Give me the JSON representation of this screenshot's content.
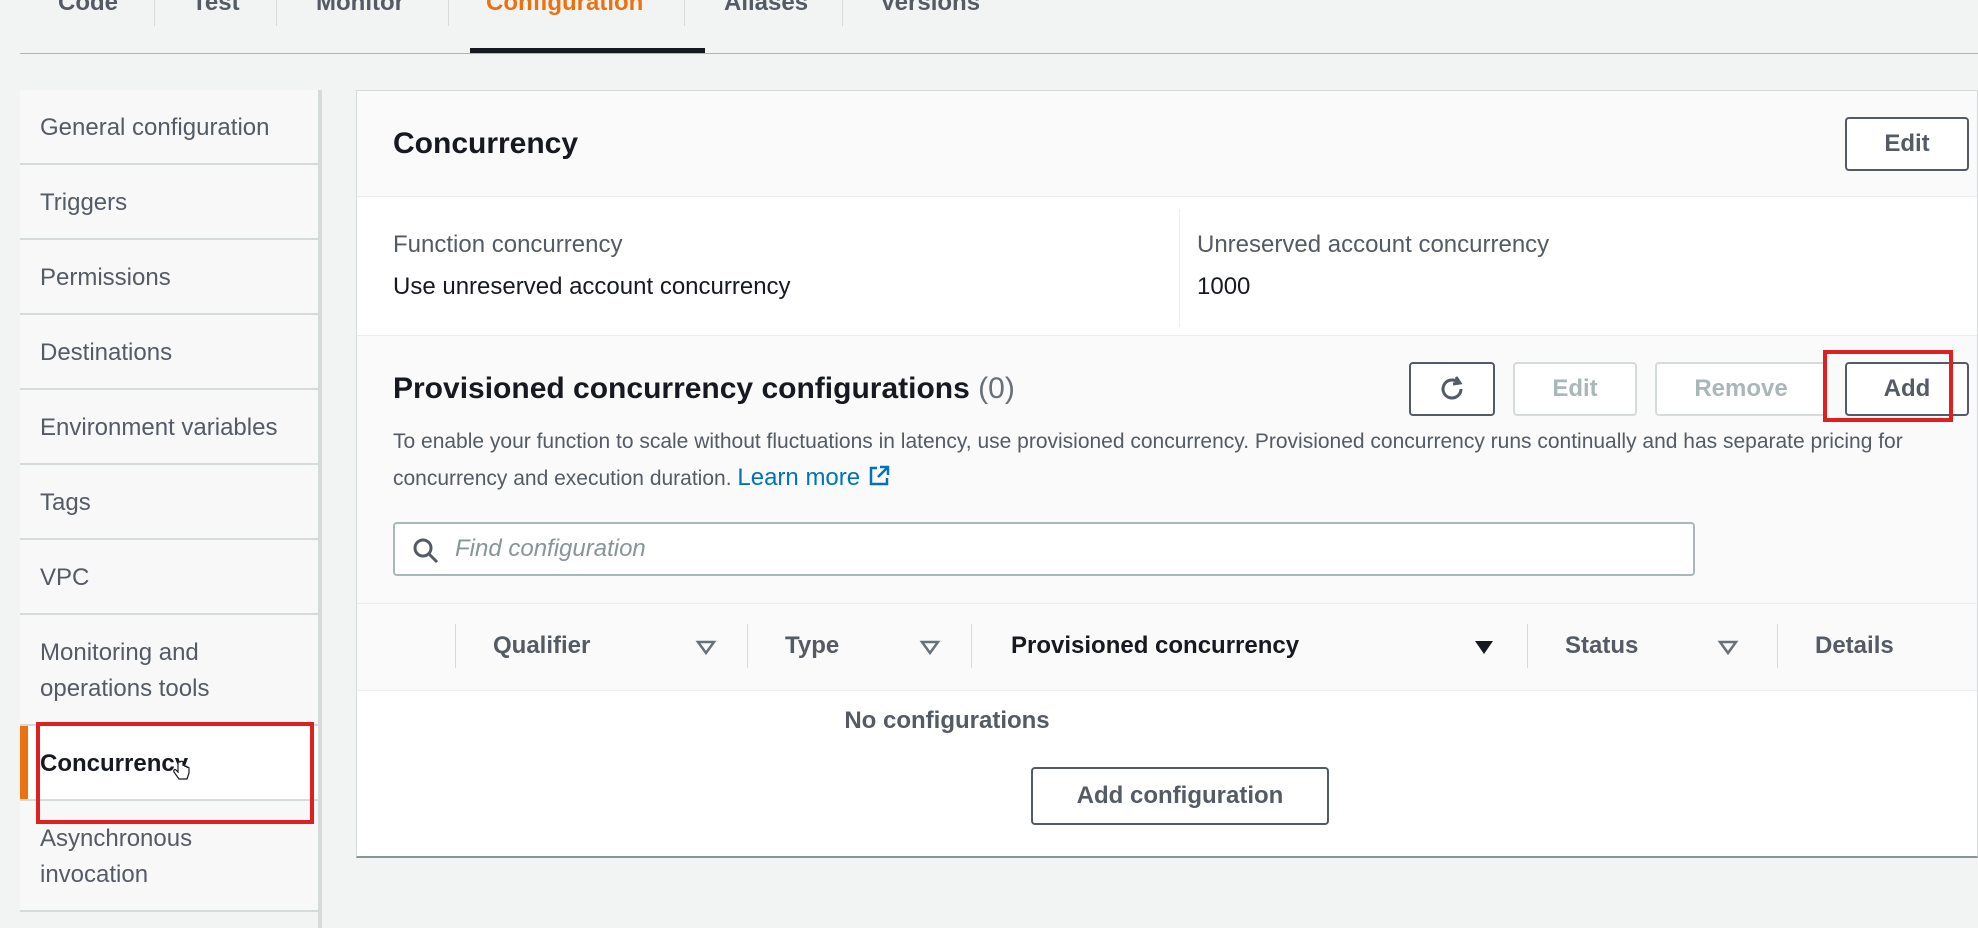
{
  "tabs": [
    {
      "label": "Code"
    },
    {
      "label": "Test"
    },
    {
      "label": "Monitor"
    },
    {
      "label": "Configuration",
      "active": true
    },
    {
      "label": "Aliases"
    },
    {
      "label": "Versions"
    }
  ],
  "sidebar": {
    "items": [
      {
        "label": "General configuration"
      },
      {
        "label": "Triggers"
      },
      {
        "label": "Permissions"
      },
      {
        "label": "Destinations"
      },
      {
        "label": "Environment variables"
      },
      {
        "label": "Tags"
      },
      {
        "label": "VPC"
      },
      {
        "label": "Monitoring and operations tools"
      },
      {
        "label": "Concurrency",
        "active": true
      },
      {
        "label": "Asynchronous invocation"
      }
    ]
  },
  "concurrency": {
    "title": "Concurrency",
    "edit_label": "Edit",
    "function_concurrency_label": "Function concurrency",
    "function_concurrency_value": "Use unreserved account concurrency",
    "unreserved_label": "Unreserved account concurrency",
    "unreserved_value": "1000"
  },
  "provisioned": {
    "title": "Provisioned concurrency configurations",
    "count": "(0)",
    "refresh_icon": "refresh-icon",
    "edit_label": "Edit",
    "remove_label": "Remove",
    "add_label": "Add",
    "description": "To enable your function to scale without fluctuations in latency, use provisioned concurrency. Provisioned concurrency runs continually and has separate pricing for concurrency and execution duration.",
    "learn_more": "Learn more",
    "search_placeholder": "Find configuration",
    "columns": {
      "qualifier": "Qualifier",
      "type": "Type",
      "provisioned": "Provisioned concurrency",
      "status": "Status",
      "details": "Details"
    },
    "empty_text": "No configurations",
    "add_config_label": "Add configuration"
  },
  "colors": {
    "accent": "#ec7211",
    "link": "#0073bb",
    "highlight": "#e02020"
  }
}
